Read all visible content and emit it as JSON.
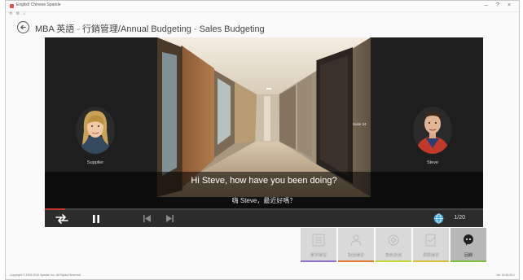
{
  "window": {
    "title": "English Chinese Sparkle",
    "toolbar": [
      "⟲",
      "⚙",
      "⌂"
    ],
    "controls": {
      "minimize": "–",
      "maximize": "?",
      "close": "×"
    }
  },
  "breadcrumb": {
    "course": "MBA 英語",
    "category": "行銷管理/Annual Budgeting",
    "lesson": "Sales Budgeting",
    "separator": "-"
  },
  "video": {
    "door_sign": "Suite 24",
    "speakers": {
      "left": "Supplier",
      "right": "Steve"
    },
    "subtitle_en": "Hi Steve, how have you been doing?",
    "subtitle_zh": "嗨 Steve，最近好嗎？",
    "progress": 0.047,
    "counter": "1/20"
  },
  "tiles": [
    {
      "label": "單字練習",
      "icon": "list-icon",
      "active": false,
      "accent": "#8e6fc9"
    },
    {
      "label": "對話練習",
      "icon": "people-icon",
      "active": false,
      "accent": "#e07a2a"
    },
    {
      "label": "角色扮演",
      "icon": "roleplay-icon",
      "active": false,
      "accent": "#c2d63c"
    },
    {
      "label": "測驗練習",
      "icon": "quiz-icon",
      "active": false,
      "accent": "#d8c23a"
    },
    {
      "label": "回饋",
      "icon": "feedback-icon",
      "active": true,
      "accent": "#7cc23c"
    }
  ],
  "footer": {
    "copyright": "Copyright © 2008-2019 Sparkle Inc. All Rights Reserved",
    "version": "Ver 19.06.06.1"
  },
  "colors": {
    "player_bg": "#1e1e1e",
    "controls_bg": "#2c2c2c",
    "progress": "#c0392b",
    "globe": "#3aa5d9"
  }
}
